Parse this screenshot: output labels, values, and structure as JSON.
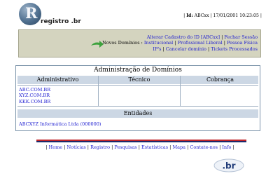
{
  "logo": {
    "letter": "R",
    "text": "registro .br"
  },
  "session": {
    "prefix": "Id:",
    "user": "ABCxx",
    "date": "17/01/2001",
    "time": "10:23:05"
  },
  "menu": {
    "label": "Novos Domínios :",
    "links": [
      "Alterar Cadastro do ID [ABCxx]",
      "Fechar Sessão",
      "Institucional",
      "Profissional Liberal",
      "Pessoa Física",
      "IP's",
      "Cancelar domínio",
      "Tickets Processados"
    ]
  },
  "admin": {
    "title": "Administração de Domínios",
    "columns": [
      "Administrativo",
      "Técnico",
      "Cobrança"
    ],
    "domains": [
      "ABC.COM.BR",
      "XYZ.COM.BR",
      "KKK.COM.BR"
    ],
    "entities_header": "Entidades",
    "entity": "ABCXYZ Informática Ltda (000000)"
  },
  "footer": {
    "links": [
      "Home",
      "Notícias",
      "Registro",
      "Pesquisas",
      "Estatísticas",
      "Mapa",
      "Contate-nos",
      "Info"
    ]
  },
  "br_logo": {
    "text": ".br"
  },
  "colors": {
    "menu_bg": "#d4d4bf",
    "header_bg": "#ccd7e4",
    "link": "#1b1bd0",
    "arrow": "#3da23d",
    "bar_red": "#c0262b",
    "bar_navy": "#1c2a6b"
  }
}
